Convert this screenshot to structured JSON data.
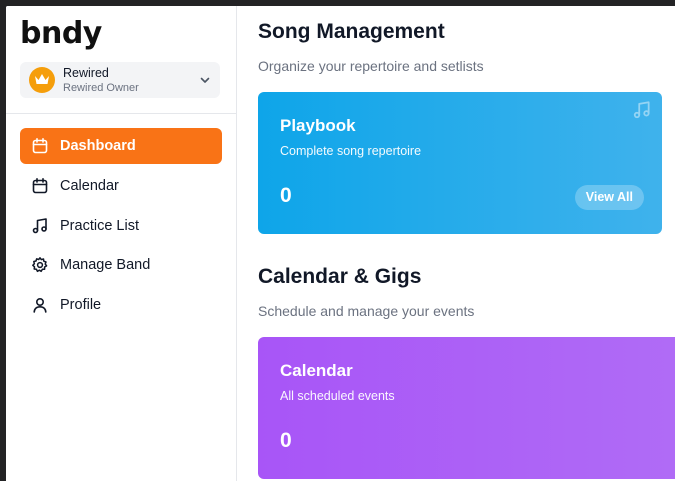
{
  "app": {
    "logo": "bndy"
  },
  "band_switcher": {
    "name": "Rewired",
    "role": "Rewired Owner",
    "avatar_icon": "crown-icon",
    "avatar_color": "#f59e0b"
  },
  "sidebar": {
    "items": [
      {
        "label": "Dashboard",
        "icon": "calendar-icon",
        "active": true
      },
      {
        "label": "Calendar",
        "icon": "calendar-icon",
        "active": false
      },
      {
        "label": "Practice List",
        "icon": "music-note-icon",
        "active": false
      },
      {
        "label": "Manage Band",
        "icon": "gear-icon",
        "active": false
      },
      {
        "label": "Profile",
        "icon": "user-icon",
        "active": false
      }
    ],
    "active_color": "#f97316"
  },
  "main": {
    "song_section": {
      "title": "Song Management",
      "subtitle": "Organize your repertoire and setlists",
      "card": {
        "title": "Playbook",
        "description": "Complete song repertoire",
        "count": "0",
        "button_label": "View All",
        "icon": "music-note-icon",
        "color": "#0ea5e9"
      }
    },
    "calendar_section": {
      "title": "Calendar & Gigs",
      "subtitle": "Schedule and manage your events",
      "card": {
        "title": "Calendar",
        "description": "All scheduled events",
        "count": "0",
        "color": "#a855f7"
      }
    }
  }
}
